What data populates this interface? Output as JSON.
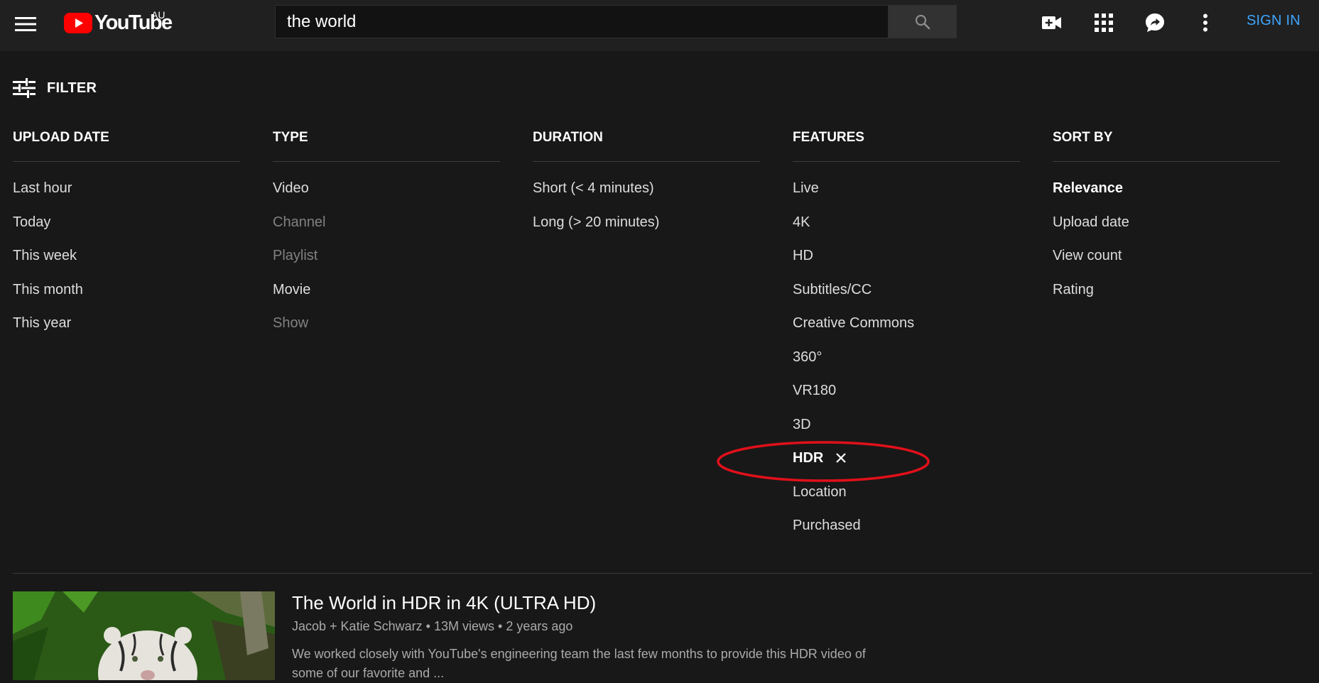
{
  "masthead": {
    "logo_text": "YouTube",
    "country_code": "AU",
    "search_value": "the world",
    "sign_in_label": "SIGN IN",
    "icons": [
      "menu-icon",
      "youtube-logo-icon",
      "search-icon",
      "create-video-icon",
      "apps-grid-icon",
      "messages-icon",
      "more-vert-icon"
    ]
  },
  "filter": {
    "toggle_label": "FILTER",
    "columns": [
      {
        "title": "UPLOAD DATE",
        "options": [
          {
            "label": "Last hour",
            "state": "normal"
          },
          {
            "label": "Today",
            "state": "normal"
          },
          {
            "label": "This week",
            "state": "normal"
          },
          {
            "label": "This month",
            "state": "normal"
          },
          {
            "label": "This year",
            "state": "normal"
          }
        ]
      },
      {
        "title": "TYPE",
        "options": [
          {
            "label": "Video",
            "state": "normal"
          },
          {
            "label": "Channel",
            "state": "disabled"
          },
          {
            "label": "Playlist",
            "state": "disabled"
          },
          {
            "label": "Movie",
            "state": "normal"
          },
          {
            "label": "Show",
            "state": "disabled"
          }
        ]
      },
      {
        "title": "DURATION",
        "options": [
          {
            "label": "Short (< 4 minutes)",
            "state": "normal"
          },
          {
            "label": "Long (> 20 minutes)",
            "state": "normal"
          }
        ]
      },
      {
        "title": "FEATURES",
        "options": [
          {
            "label": "Live",
            "state": "normal"
          },
          {
            "label": "4K",
            "state": "normal"
          },
          {
            "label": "HD",
            "state": "normal"
          },
          {
            "label": "Subtitles/CC",
            "state": "normal"
          },
          {
            "label": "Creative Commons",
            "state": "normal"
          },
          {
            "label": "360°",
            "state": "normal"
          },
          {
            "label": "VR180",
            "state": "normal"
          },
          {
            "label": "3D",
            "state": "normal"
          },
          {
            "label": "HDR",
            "state": "selected"
          },
          {
            "label": "Location",
            "state": "normal"
          },
          {
            "label": "Purchased",
            "state": "normal"
          }
        ]
      },
      {
        "title": "SORT BY",
        "options": [
          {
            "label": "Relevance",
            "state": "selected"
          },
          {
            "label": "Upload date",
            "state": "normal"
          },
          {
            "label": "View count",
            "state": "normal"
          },
          {
            "label": "Rating",
            "state": "normal"
          }
        ]
      }
    ]
  },
  "result": {
    "title": "The World in HDR in 4K (ULTRA HD)",
    "channel": "Jacob + Katie Schwarz",
    "views": "13M views",
    "age": "2 years ago",
    "separator": "•",
    "description_line1": "We worked closely with YouTube's engineering team the last few months to provide this HDR video of",
    "description_line2": "some of our favorite and ..."
  },
  "colors": {
    "page_bg": "#181818",
    "masthead_bg": "#202020",
    "accent_blue": "#3ea6ff",
    "youtube_red": "#ff0000",
    "highlight_red": "#e0101a",
    "muted_text": "#aaaaaa",
    "disabled_text": "#818181"
  }
}
